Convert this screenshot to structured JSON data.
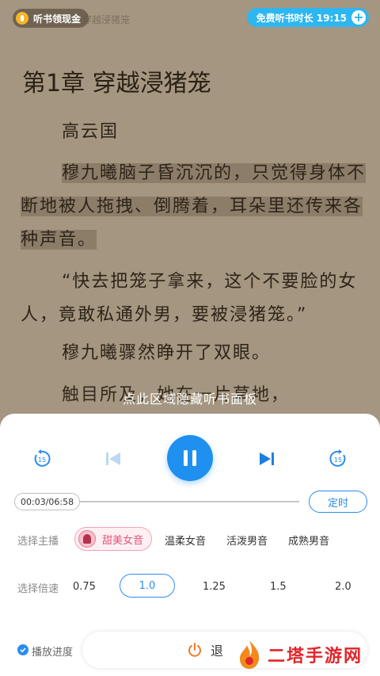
{
  "top_bar": {
    "listen_reward_label": "听书领现金",
    "ghost_text": "穿越浸猪笼",
    "free_time_label": "免费听书时长 19:15",
    "add_symbol": "+"
  },
  "reader": {
    "chapter_title": "第1章  穿越浸猪笼",
    "paragraphs": [
      "高云国",
      "穆九曦脑子昏沉沉的，只觉得身体不断地被人拖拽、倒腾着，耳朵里还传来各种声音。",
      "“快去把笼子拿来，这个不要脸的女人，竟敢私通外男，要被浸猪笼。”",
      "穆九曦骤然睁开了双眼。",
      "触目所及，她在一片草地，"
    ]
  },
  "panel": {
    "hide_hint": "点此区域隐藏听书面板",
    "skip_back_seconds": "15",
    "skip_fwd_seconds": "15",
    "time_display": "00:03/06:58",
    "timer_label": "定时",
    "voice_row_label": "选择主播",
    "voices": [
      "甜美女音",
      "温柔女音",
      "活泼男音",
      "成熟男音"
    ],
    "speed_row_label": "选择倍速",
    "speeds": [
      "0.75",
      "1.0",
      "1.25",
      "1.5",
      "2.0"
    ],
    "sync_progress_label": "播放进度",
    "exit_label": "退"
  },
  "watermark": {
    "text": "二塔手游网"
  },
  "colors": {
    "accent": "#1f8ff0",
    "free_pill": "#2eb6f0",
    "voice_selected": "#e2547a",
    "reader_bg": "#a49680"
  }
}
